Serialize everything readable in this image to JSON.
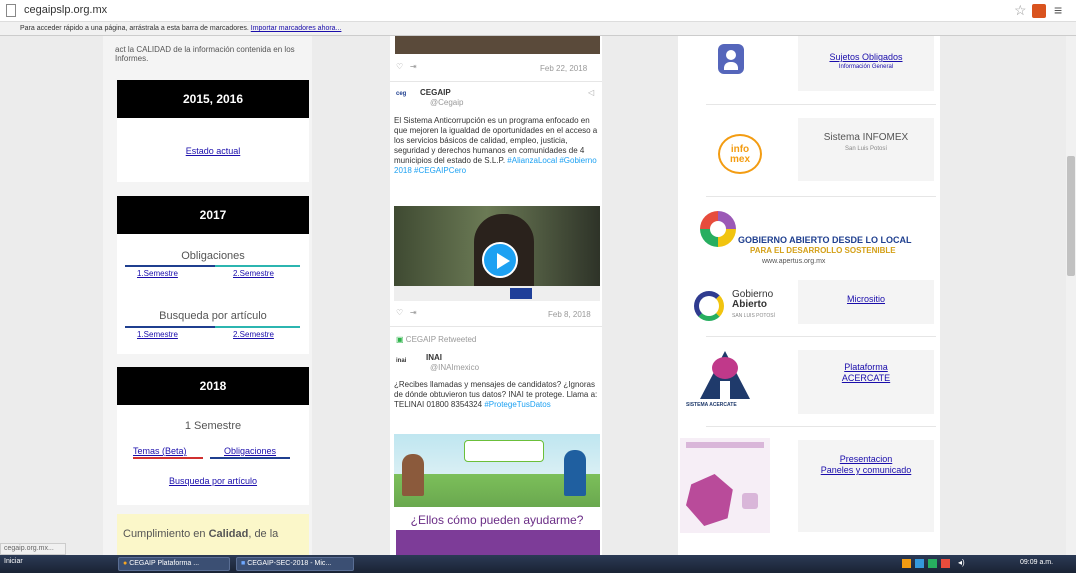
{
  "browser": {
    "url": "cegaipslp.org.mx",
    "bookmarks_msg": "Para acceder rápido a una página, arrástrala a esta barra de marcadores.",
    "bookmarks_link": "Importar marcadores ahora..."
  },
  "left": {
    "intro": "act la CALIDAD de la información contenida en los Informes.",
    "y2015": {
      "title": "2015, 2016",
      "link": "Estado actual"
    },
    "y2017": {
      "title": "2017",
      "oblig_title": "Obligaciones",
      "oblig_s1": "1.Semestre",
      "oblig_s2": "2.Semestre",
      "busq_title": "Busqueda por artículo",
      "busq_s1": "1.Semestre",
      "busq_s2": "2.Semestre"
    },
    "y2018": {
      "title": "2018",
      "semester": "1 Semestre",
      "link_temas": "Temas (Beta)",
      "link_oblig": "Obligaciones",
      "link_busq": "Busqueda por artículo"
    },
    "calidad": {
      "prefix": "Cumplimiento en ",
      "bold": "Calidad",
      "suffix": ", de la"
    }
  },
  "middle": {
    "tweet1_date": "Feb 22, 2018",
    "tweet2": {
      "name": "CEGAIP",
      "handle": "@Cegaip",
      "text": "El Sistema Anticorrupción es un programa enfocado en que mejoren la igualdad de oportunidades en el acceso a los servicios básicos de calidad, empleo, justicia, seguridad y derechos humanos en comunidades de 4 municipios del estado de S.L.P.",
      "tags": "#AlianzaLocal #Gobierno 2018 #CEGAIPCero",
      "date": "Feb 8, 2018"
    },
    "tweet3": {
      "retweet": "CEGAIP Retweeted",
      "name": "INAI",
      "handle": "@INAImexico",
      "text": "¿Recibes llamadas y mensajes de candidatos? ¿Ignoras de dónde obtuvieron tus datos? INAI te protege. Llama a: TELINAI 01800 8354324",
      "tags": "#ProtegeTusDatos",
      "banner": "¿Ellos cómo pueden ayudarme?"
    }
  },
  "right": {
    "sujetos": {
      "title": "Sujetos Obligados",
      "sub": "Información General"
    },
    "infomex": {
      "title": "Sistema INFOMEX",
      "sub": "San Luis Potosí",
      "logo_top": "info",
      "logo_bot": "mex"
    },
    "gobierno": {
      "line1": "GOBIERNO ABIERTO DESDE LO LOCAL",
      "line2": "PARA EL DESARROLLO SOSTENIBLE",
      "url": "www.apertus.org.mx"
    },
    "micrositio": {
      "logo1": "Gobierno",
      "logo2": "Abierto",
      "logo3": "SAN LUIS POTOSÍ",
      "link": "Micrositio"
    },
    "acercate": {
      "link1": "Plataforma",
      "link2": "ACERCATE",
      "logo_text": "SISTEMA ACERCATE"
    },
    "presentacion": {
      "link1": "Presentacion",
      "link2": "Paneles y comunicado"
    }
  },
  "status": "cegaip.org.mx...",
  "taskbar": {
    "start": "Iniciar",
    "task1": "CEGAIP Plataforma ...",
    "task2": "CEGAIP-SEC-2018 - Mic...",
    "clock": "09:09 a.m."
  }
}
